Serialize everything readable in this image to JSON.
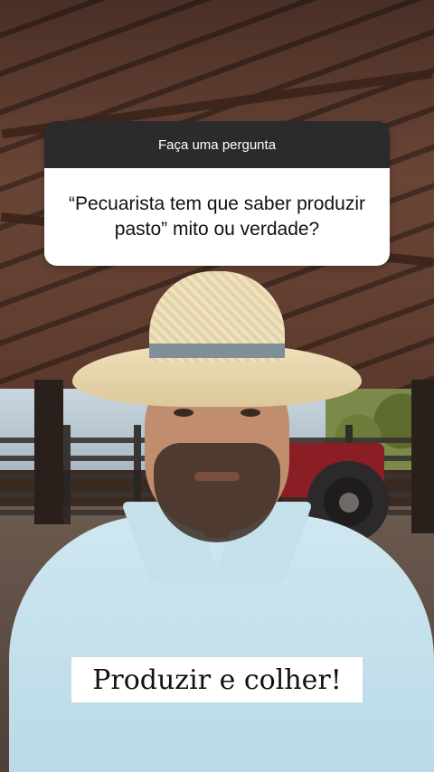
{
  "question_box": {
    "header": "Faça uma pergunta",
    "question": "“Pecuarista tem que saber produzir pasto” mito ou verdade?"
  },
  "caption": {
    "text": "Produzir e colher!"
  },
  "colors": {
    "sticker_header_bg": "#2b2b2b",
    "sticker_body_bg": "#ffffff",
    "caption_bg": "#ffffff"
  }
}
